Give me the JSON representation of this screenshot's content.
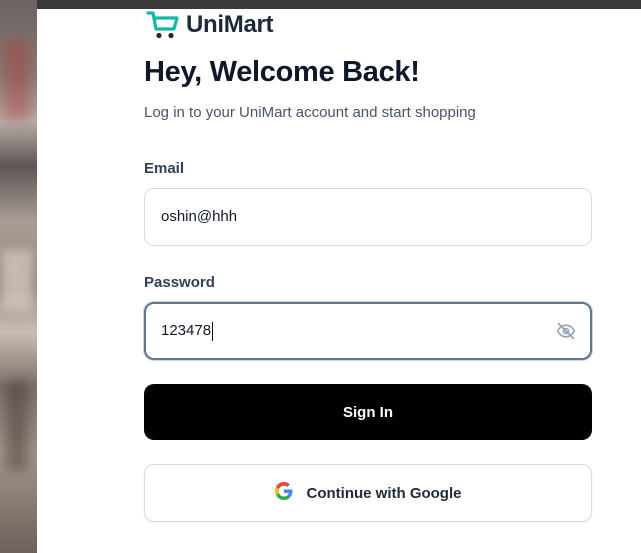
{
  "brand": {
    "name": "UniMart",
    "accent_color": "#14b8a6",
    "logo_icon": "shopping-cart-icon"
  },
  "header": {
    "title": "Hey, Welcome Back!",
    "subtitle": "Log in to your UniMart account and start shopping"
  },
  "form": {
    "email_label": "Email",
    "email_value": "oshin@hhh",
    "password_label": "Password",
    "password_value": "123478",
    "password_toggle_icon": "eye-off-icon"
  },
  "actions": {
    "signin_label": "Sign In",
    "google_label": "Continue with Google",
    "google_icon": "google-icon"
  }
}
